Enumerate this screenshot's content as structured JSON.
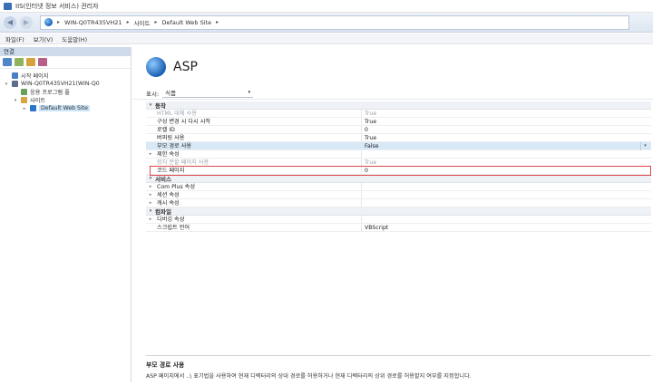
{
  "window": {
    "title": "IIS(인터넷 정보 서비스) 관리자"
  },
  "address": {
    "crumbs": [
      "WIN-Q0TR435VH21",
      "사이트",
      "Default Web Site"
    ],
    "separator": "▸"
  },
  "menu": {
    "items": [
      "파일(F)",
      "보기(V)",
      "도움말(H)"
    ]
  },
  "connections": {
    "header": "연결",
    "tree": [
      {
        "label": "시작 페이지",
        "level": 0,
        "expander": "",
        "color": "#4a7fc1"
      },
      {
        "label": "WIN-Q0TR435VH21(WIN-Q0",
        "level": 0,
        "expander": "▾",
        "color": "#5b6f8a"
      },
      {
        "label": "응용 프로그램 풀",
        "level": 1,
        "expander": "",
        "color": "#6aa05a"
      },
      {
        "label": "사이트",
        "level": 1,
        "expander": "▾",
        "color": "#d9a441"
      },
      {
        "label": "Default Web Site",
        "level": 2,
        "expander": "▸",
        "color": "#2a77c9",
        "selected": true
      }
    ]
  },
  "feature": {
    "title": "ASP"
  },
  "group_by": {
    "label": "표시:",
    "value": "식품",
    "caret": "▾"
  },
  "grid": {
    "categories": [
      {
        "name": "동작",
        "rows": [
          {
            "name": "HTML 대체 사용",
            "value": "True",
            "dim": true
          },
          {
            "name": "구성 변경 시 다시 시작",
            "value": "True"
          },
          {
            "name": "로캘 ID",
            "value": "0"
          },
          {
            "name": "버퍼링 사용",
            "value": "True"
          },
          {
            "name": "부모 경로 사용",
            "value": "False",
            "selected": true
          },
          {
            "name": "제한 속성",
            "value": "",
            "expander": "▸"
          },
          {
            "name": "장치 분할 페이지 사용",
            "value": "True",
            "dim": true
          },
          {
            "name": "코드 페이지",
            "value": "0"
          }
        ]
      },
      {
        "name": "서비스",
        "rows": [
          {
            "name": "Com Plus 속성",
            "value": "",
            "expander": "▸"
          },
          {
            "name": "세션 속성",
            "value": "",
            "expander": "▸"
          },
          {
            "name": "캐시 속성",
            "value": "",
            "expander": "▸"
          }
        ]
      },
      {
        "name": "컴파일",
        "rows": [
          {
            "name": "디버깅 속성",
            "value": "",
            "expander": "▸"
          },
          {
            "name": "스크립트 언어",
            "value": "VBScript"
          }
        ]
      }
    ],
    "dropdown_glyph": "▾"
  },
  "description": {
    "title": "부모 경로 사용",
    "text": "ASP 페이지에서 ..\\ 표기법을 사용하여 현재 디렉터리의 상대 경로를 허용하거나 현재 디렉터리의 상위 경로를 허용할지 여부를 지정합니다."
  },
  "colors": {
    "highlight": "#e0474c",
    "selection": "#d7e8f7"
  }
}
